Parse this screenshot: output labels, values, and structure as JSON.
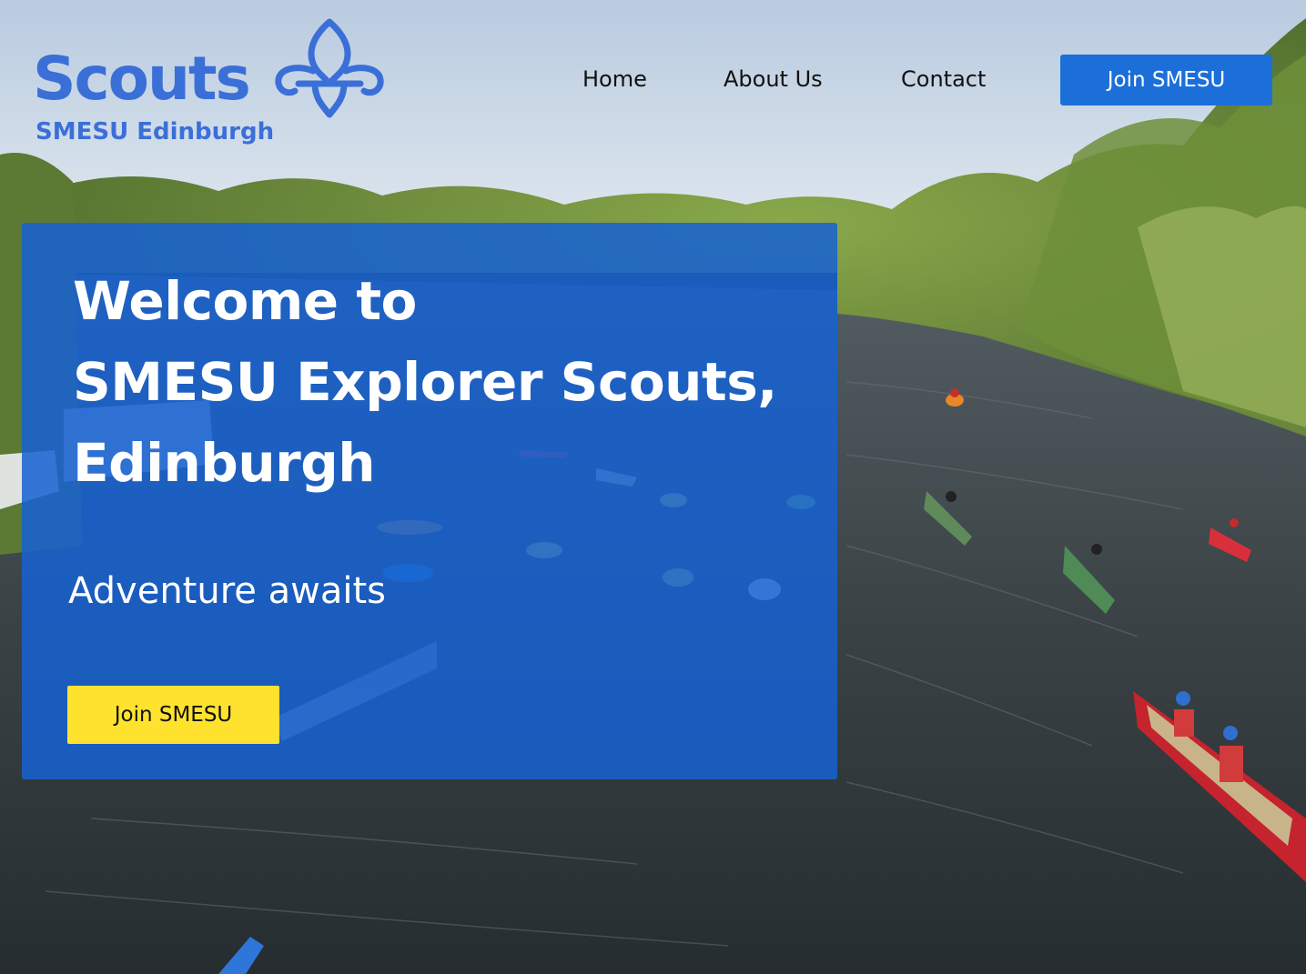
{
  "header": {
    "logo": {
      "wordmark": "Scouts",
      "subtitle": "SMESU Edinburgh",
      "icon": "fleur-de-lis-icon"
    },
    "nav": {
      "items": [
        {
          "label": "Home"
        },
        {
          "label": "About Us"
        },
        {
          "label": "Contact"
        }
      ],
      "join_label": "Join SMESU"
    }
  },
  "hero": {
    "title_lines": [
      "Welcome to",
      "SMESU Explorer Scouts,",
      "Edinburgh"
    ],
    "subtitle": "Adventure awaits",
    "cta_label": "Join SMESU"
  },
  "background": {
    "description_icon": "river-kayaking-photo"
  },
  "colors": {
    "brand_blue": "#3b6fd8",
    "nav_button": "#1c6fd9",
    "hero_panel": "#1662d2",
    "cta_yellow": "#ffe22e"
  }
}
